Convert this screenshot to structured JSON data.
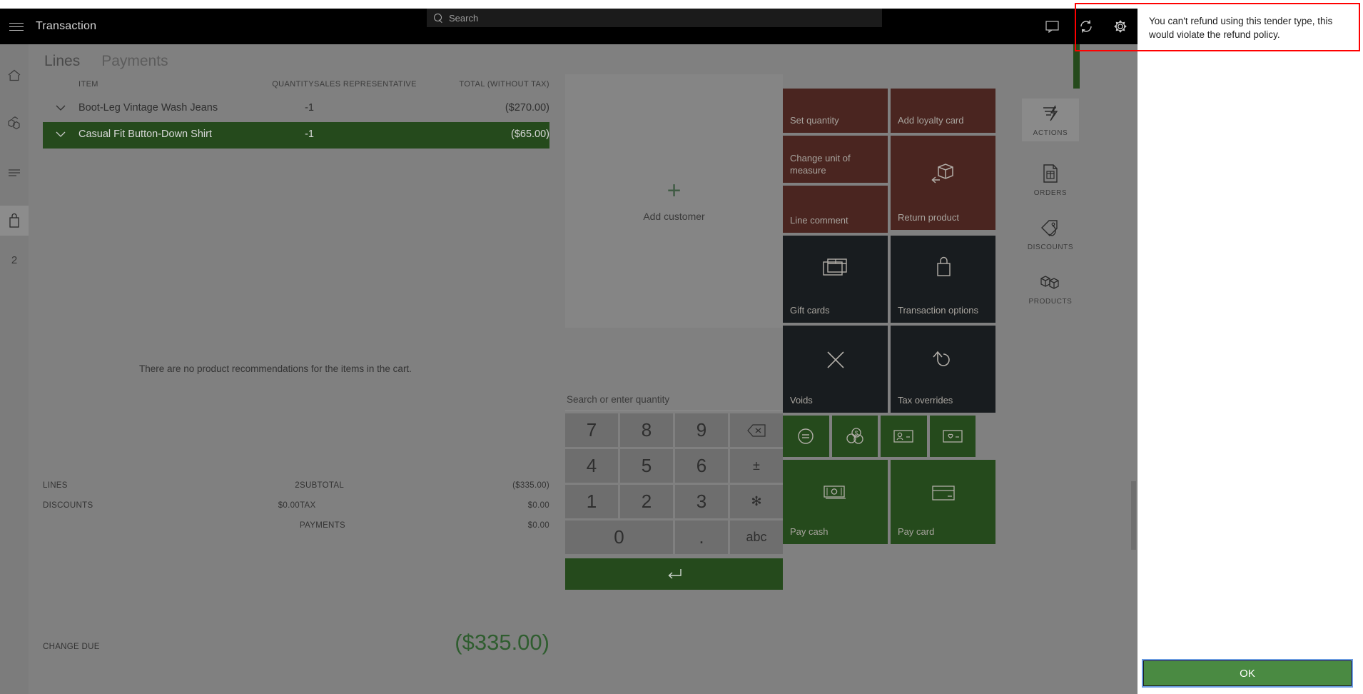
{
  "header": {
    "menu_icon": "hamburger-icon",
    "title": "Transaction",
    "search_placeholder": "Search",
    "search_icon": "search-icon",
    "icons": [
      "comment-icon",
      "refresh-icon",
      "gear-icon"
    ]
  },
  "left_rail": {
    "items": [
      {
        "icon": "home-icon",
        "name": "home"
      },
      {
        "icon": "products-icon",
        "name": "products"
      },
      {
        "icon": "list-icon",
        "name": "list"
      },
      {
        "icon": "cart-icon",
        "name": "cart",
        "active": true
      }
    ],
    "badge_count": "2"
  },
  "tabs": [
    {
      "label": "Lines",
      "active": true
    },
    {
      "label": "Payments",
      "active": false
    }
  ],
  "lines": {
    "columns": [
      "ITEM",
      "QUANTITY",
      "SALES REPRESENTATIVE",
      "TOTAL (WITHOUT TAX)"
    ],
    "rows": [
      {
        "name": "Boot-Leg Vintage Wash Jeans",
        "quantity": "-1",
        "sales_rep": "",
        "total": "($270.00)",
        "selected": false
      },
      {
        "name": "Casual Fit Button-Down Shirt",
        "quantity": "-1",
        "sales_rep": "",
        "total": "($65.00)",
        "selected": true
      }
    ],
    "empty_recommendations": "There are no product recommendations for the items in the cart."
  },
  "totals": {
    "lines_label": "LINES",
    "lines_value": "2",
    "discounts_label": "DISCOUNTS",
    "discounts_value": "$0.00",
    "subtotal_label": "SUBTOTAL",
    "subtotal_value": "($335.00)",
    "tax_label": "TAX",
    "tax_value": "$0.00",
    "payments_label": "PAYMENTS",
    "payments_value": "$0.00",
    "change_due_label": "CHANGE DUE",
    "change_due_value": "($335.00)"
  },
  "customer": {
    "add_label": "Add customer",
    "plus_icon": "plus-icon"
  },
  "numpad": {
    "placeholder": "Search or enter quantity",
    "keys": [
      "7",
      "8",
      "9",
      "backspace",
      "4",
      "5",
      "6",
      "±",
      "1",
      "2",
      "3",
      "✻",
      "0",
      ".",
      "abc"
    ],
    "backspace_icon": "backspace-icon",
    "enter_icon": "enter-icon"
  },
  "tiles": {
    "set_quantity": "Set quantity",
    "add_loyalty_card": "Add loyalty card",
    "change_unit_of_measure": "Change unit of measure",
    "line_comment": "Line comment",
    "return_product": "Return product",
    "return_product_icon": "return-box-icon",
    "gift_cards": "Gift cards",
    "gift_cards_icon": "gift-card-icon",
    "transaction_options": "Transaction options",
    "transaction_options_icon": "bag-icon",
    "voids": "Voids",
    "voids_icon": "close-x-icon",
    "tax_overrides": "Tax overrides",
    "tax_overrides_icon": "undo-arrow-icon",
    "mini_icons": [
      "equals-circle-icon",
      "currency-coins-icon",
      "customer-card-icon",
      "loyalty-card-icon"
    ],
    "pay_cash": "Pay cash",
    "pay_cash_icon": "cash-icon",
    "pay_card": "Pay card",
    "pay_card_icon": "credit-card-icon"
  },
  "right_rail": [
    {
      "label": "ACTIONS",
      "icon": "actions-lightning-icon",
      "active": true
    },
    {
      "label": "ORDERS",
      "icon": "orders-document-icon",
      "active": false
    },
    {
      "label": "DISCOUNTS",
      "icon": "discount-tag-icon",
      "active": false
    },
    {
      "label": "PRODUCTS",
      "icon": "products-boxes-icon",
      "active": false
    }
  ],
  "dialog": {
    "message": "You can't refund using this tender type, this would violate the refund policy.",
    "ok_label": "OK",
    "highlight_color": "#ff0000"
  },
  "colors": {
    "accent_green": "#254a1c",
    "tile_brown": "#4a2520",
    "tile_dark": "#181c1f",
    "ok_green": "#4a8a42",
    "background": "#808080"
  }
}
